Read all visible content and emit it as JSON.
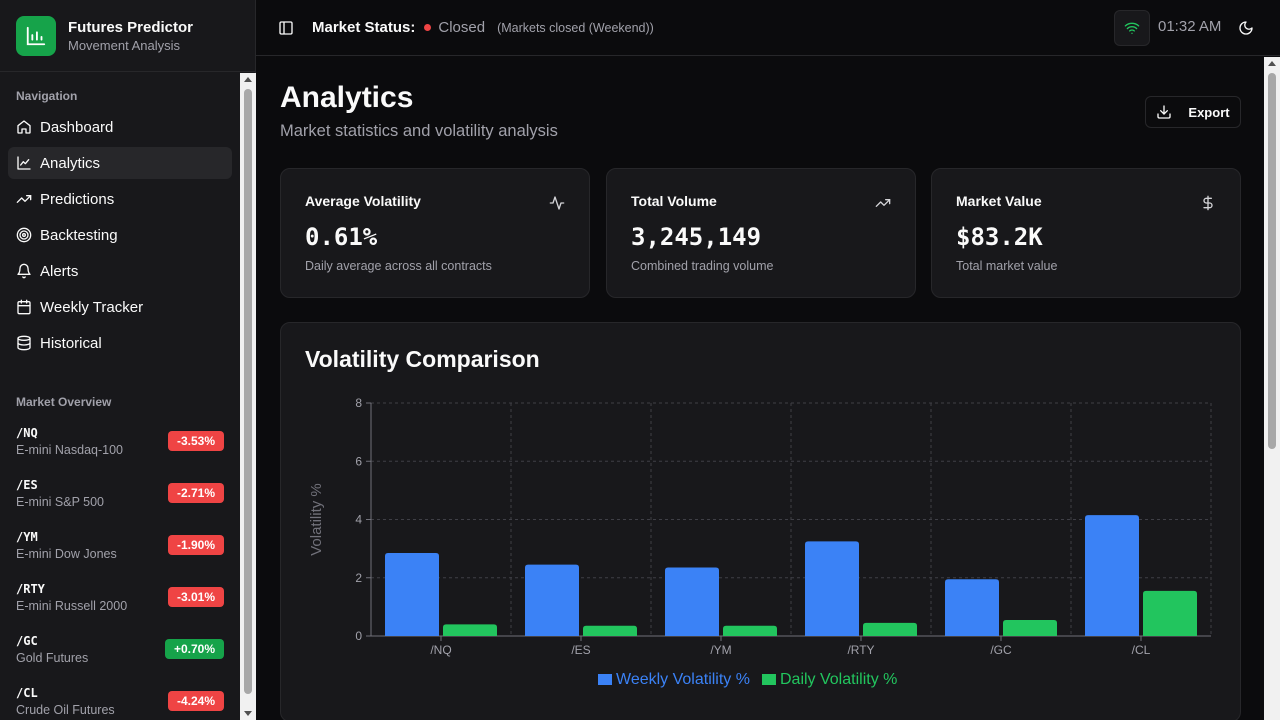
{
  "app": {
    "title": "Futures Predictor",
    "subtitle": "Movement Analysis",
    "logo_icon": "bar-chart-icon"
  },
  "sidebar": {
    "nav_label": "Navigation",
    "items": [
      {
        "label": "Dashboard",
        "icon": "home-icon",
        "active": false
      },
      {
        "label": "Analytics",
        "icon": "line-chart-icon",
        "active": true
      },
      {
        "label": "Predictions",
        "icon": "trending-up-icon",
        "active": false
      },
      {
        "label": "Backtesting",
        "icon": "target-icon",
        "active": false
      },
      {
        "label": "Alerts",
        "icon": "bell-icon",
        "active": false
      },
      {
        "label": "Weekly Tracker",
        "icon": "calendar-icon",
        "active": false
      },
      {
        "label": "Historical",
        "icon": "database-icon",
        "active": false
      }
    ],
    "market_label": "Market Overview",
    "markets": [
      {
        "symbol": "/NQ",
        "name": "E-mini Nasdaq-100",
        "change": "-3.53%",
        "color": "#ef4444"
      },
      {
        "symbol": "/ES",
        "name": "E-mini S&P 500",
        "change": "-2.71%",
        "color": "#ef4444"
      },
      {
        "symbol": "/YM",
        "name": "E-mini Dow Jones",
        "change": "-1.90%",
        "color": "#ef4444"
      },
      {
        "symbol": "/RTY",
        "name": "E-mini Russell 2000",
        "change": "-3.01%",
        "color": "#ef4444"
      },
      {
        "symbol": "/GC",
        "name": "Gold Futures",
        "change": "+0.70%",
        "color": "#16a34a"
      },
      {
        "symbol": "/CL",
        "name": "Crude Oil Futures",
        "change": "-4.24%",
        "color": "#ef4444"
      }
    ]
  },
  "header": {
    "market_status_label": "Market Status:",
    "status": "Closed",
    "status_color": "#ef4444",
    "status_note": "(Markets closed (Weekend))",
    "time": "01:32 AM",
    "connection_color": "#22c55e"
  },
  "page": {
    "title": "Analytics",
    "subtitle": "Market statistics and volatility analysis",
    "export_label": "Export"
  },
  "stats": [
    {
      "title": "Average Volatility",
      "value": "0.61%",
      "desc": "Daily average across all contracts",
      "icon": "activity-icon"
    },
    {
      "title": "Total Volume",
      "value": "3,245,149",
      "desc": "Combined trading volume",
      "icon": "trending-up-icon"
    },
    {
      "title": "Market Value",
      "value": "$83.2K",
      "desc": "Total market value",
      "icon": "dollar-icon"
    }
  ],
  "chart": {
    "title": "Volatility Comparison"
  },
  "chart_data": {
    "type": "bar",
    "categories": [
      "/NQ",
      "/ES",
      "/YM",
      "/RTY",
      "/GC",
      "/CL"
    ],
    "series": [
      {
        "name": "Weekly Volatility %",
        "color": "#3b82f6",
        "values": [
          2.85,
          2.45,
          2.35,
          3.25,
          1.95,
          4.15
        ]
      },
      {
        "name": "Daily Volatility %",
        "color": "#22c55e",
        "values": [
          0.4,
          0.35,
          0.35,
          0.45,
          0.55,
          1.55
        ]
      }
    ],
    "ylabel": "Volatility %",
    "ylim": [
      0,
      8
    ],
    "yticks": [
      0,
      2,
      4,
      6,
      8
    ],
    "grid": true,
    "legend": "bottom"
  }
}
